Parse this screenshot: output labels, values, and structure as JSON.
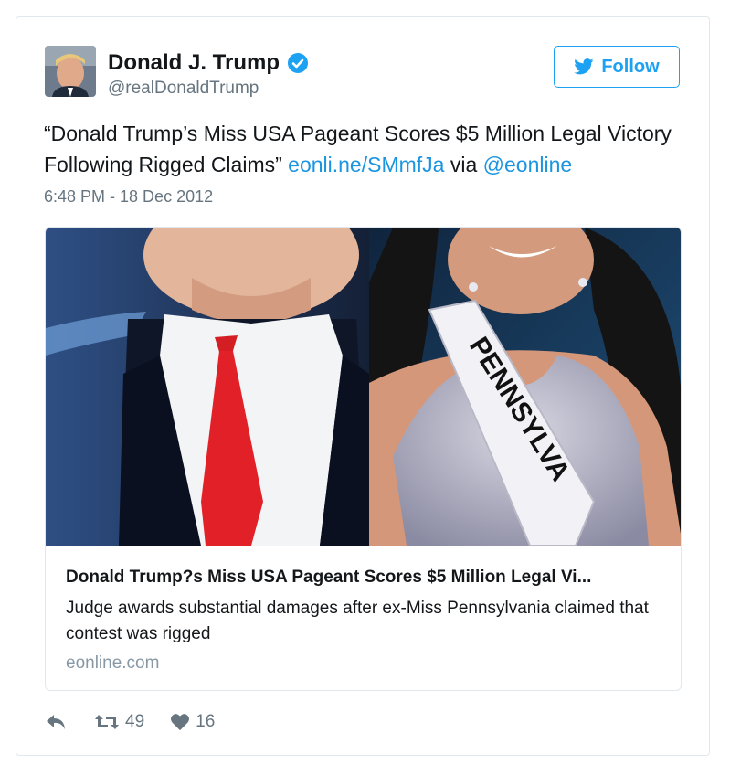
{
  "author": {
    "name": "Donald J. Trump",
    "handle": "@realDonaldTrump",
    "verified": true
  },
  "follow_button": {
    "label": "Follow"
  },
  "tweet": {
    "text_before": "“Donald Trump’s Miss USA Pageant Scores $5 Million Legal Victory Following Rigged Claims” ",
    "link": "eonli.ne/SMmfJa",
    "via": " via ",
    "mention": "@eonline",
    "timestamp": "6:48 PM - 18 Dec 2012"
  },
  "card": {
    "title": "Donald Trump?s Miss USA Pageant Scores $5 Million Legal Vi...",
    "description": "Judge awards substantial damages after ex-Miss Pennsylvania claimed that contest was rigged",
    "domain": "eonline.com",
    "sash_text": "PENNSYLVA"
  },
  "actions": {
    "retweets": "49",
    "likes": "16"
  },
  "colors": {
    "brand_blue": "#1da1f2",
    "link_blue": "#1b95e0",
    "muted": "#66757f",
    "border": "#e1e8ed"
  },
  "icons": {
    "verified": "verified-badge-icon",
    "bird": "twitter-bird-icon",
    "reply": "reply-icon",
    "retweet": "retweet-icon",
    "like": "heart-icon"
  }
}
